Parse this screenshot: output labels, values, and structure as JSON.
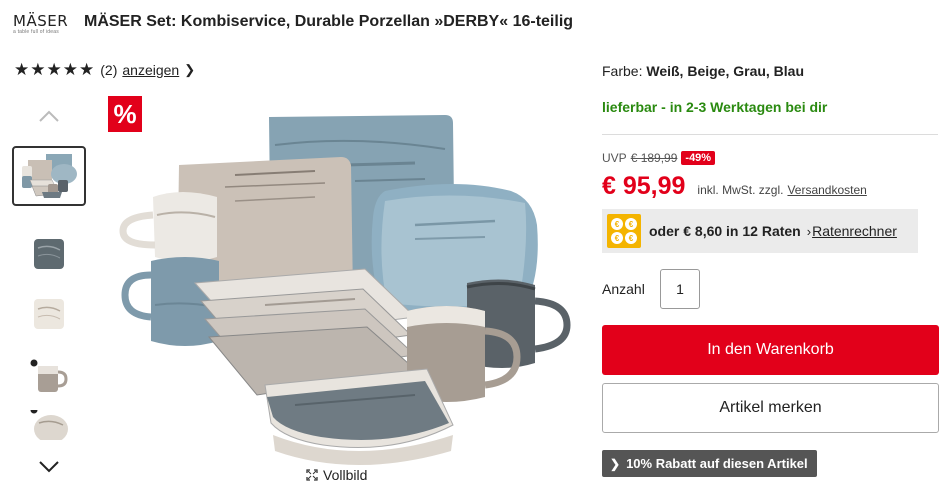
{
  "header": {
    "brand_name": "MÄSER",
    "brand_tagline": "a table full of ideas",
    "title": "MÄSER Set: Kombiservice, Durable Porzellan »DERBY« 16-teilig"
  },
  "rating": {
    "stars": 5,
    "count": "(2)",
    "link": "anzeigen"
  },
  "gallery": {
    "sale_badge": "%",
    "fullscreen": "Vollbild"
  },
  "product": {
    "color_label": "Farbe:",
    "color_value": "Weiß, Beige, Grau, Blau",
    "delivery": "lieferbar - in 2-3 Werktagen bei dir",
    "uvp_label": "UVP",
    "uvp_old": "€ 189,99",
    "discount": "-49%",
    "price": "€ 95,99",
    "tax_note": "inkl. MwSt. zzgl.",
    "shipping_link": "Versandkosten",
    "installment_text": "oder € 8,60 in 12 Raten",
    "installment_link": "Ratenrechner",
    "qty_label": "Anzahl",
    "qty_value": "1",
    "cart_button": "In den Warenkorb",
    "wishlist_button": "Artikel merken",
    "coupon": "10% Rabatt auf diesen Artikel"
  },
  "colors": {
    "accent": "#e2001a",
    "success": "#2a8a10",
    "installment": "#f4b400",
    "coupon_bg": "#555555"
  }
}
